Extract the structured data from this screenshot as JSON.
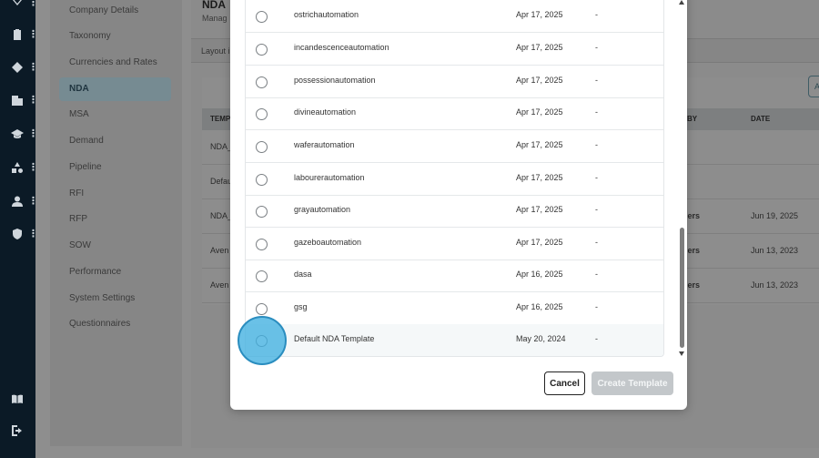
{
  "rail": {
    "icons": [
      "chevron-icon",
      "clipboard-icon",
      "diamond-icon",
      "building-icon",
      "graduation-cap-icon",
      "shapes-icon",
      "user-icon",
      "shield-icon",
      "book-icon",
      "logout-icon"
    ]
  },
  "sidenav": {
    "items": [
      {
        "label": "Company Details"
      },
      {
        "label": "Taxonomy"
      },
      {
        "label": "Currencies and Rates"
      },
      {
        "label": "NDA",
        "active": true
      },
      {
        "label": "MSA"
      },
      {
        "label": "Demand"
      },
      {
        "label": "Pipeline"
      },
      {
        "label": "RFI"
      },
      {
        "label": "RFP"
      },
      {
        "label": "SOW"
      },
      {
        "label": "Performance"
      },
      {
        "label": "System Settings"
      },
      {
        "label": "Questionnaires"
      }
    ]
  },
  "main": {
    "title": "NDA",
    "subtitle": "Manag",
    "tab": "Layout i",
    "add_button": "A",
    "columns": [
      "TEMP",
      "BY",
      "DATE"
    ],
    "rows": [
      {
        "name": "NDA_",
        "by": "",
        "date": ""
      },
      {
        "name": "Defau",
        "by": "",
        "date": ""
      },
      {
        "name": "NDA_",
        "by": "gers",
        "date": "Jun 19, 2025"
      },
      {
        "name": "Aven",
        "by": "gers",
        "date": "Jun 13, 2023"
      },
      {
        "name": "Aven",
        "by": "gers",
        "date": "Jun 13, 2023"
      }
    ]
  },
  "modal": {
    "templates": [
      {
        "name": "ostrichautomation",
        "date": "Apr 17, 2025",
        "extra": "-"
      },
      {
        "name": "incandescenceautomation",
        "date": "Apr 17, 2025",
        "extra": "-"
      },
      {
        "name": "possessionautomation",
        "date": "Apr 17, 2025",
        "extra": "-"
      },
      {
        "name": "divineautomation",
        "date": "Apr 17, 2025",
        "extra": "-"
      },
      {
        "name": "waferautomation",
        "date": "Apr 17, 2025",
        "extra": "-"
      },
      {
        "name": "labourerautomation",
        "date": "Apr 17, 2025",
        "extra": "-"
      },
      {
        "name": "grayautomation",
        "date": "Apr 17, 2025",
        "extra": "-"
      },
      {
        "name": "gazeboautomation",
        "date": "Apr 17, 2025",
        "extra": "-"
      },
      {
        "name": "dasa",
        "date": "Apr 16, 2025",
        "extra": "-"
      },
      {
        "name": "gsg",
        "date": "Apr 16, 2025",
        "extra": "-"
      },
      {
        "name": "Default NDA Template",
        "date": "May 20, 2024",
        "extra": "-"
      }
    ],
    "cancel_label": "Cancel",
    "create_label": "Create Template"
  },
  "colors": {
    "accent": "#40b0e0",
    "disabled_button": "#c3c7ca",
    "rail": "#0b1a26"
  }
}
